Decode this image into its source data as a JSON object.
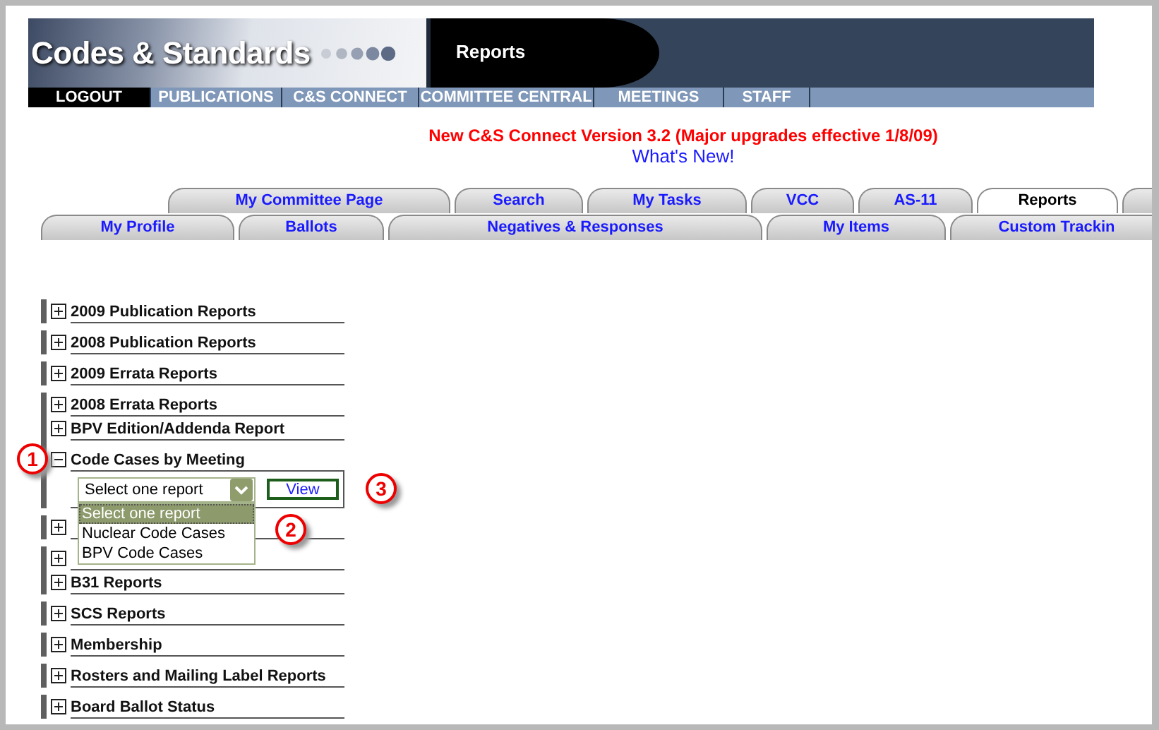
{
  "header": {
    "title": "Codes & Standards",
    "page": "Reports"
  },
  "nav": [
    {
      "label": "LOGOUT",
      "selected": true
    },
    {
      "label": "PUBLICATIONS",
      "selected": false
    },
    {
      "label": "C&S CONNECT",
      "selected": false
    },
    {
      "label": "COMMITTEE CENTRAL",
      "selected": false
    },
    {
      "label": "MEETINGS",
      "selected": false
    },
    {
      "label": "STAFF",
      "selected": false
    }
  ],
  "notice": {
    "text": "New C&S Connect Version 3.2 (Major upgrades effective 1/8/09)",
    "link": "What's New!"
  },
  "tabs_top": [
    {
      "label": "My Committee Page",
      "selected": false
    },
    {
      "label": "Search",
      "selected": false
    },
    {
      "label": "My Tasks",
      "selected": false
    },
    {
      "label": "VCC",
      "selected": false
    },
    {
      "label": "AS-11",
      "selected": false
    },
    {
      "label": "Reports",
      "selected": true
    },
    {
      "selected": false
    }
  ],
  "tabs_bottom": [
    {
      "label": "My Profile",
      "selected": false
    },
    {
      "label": "Ballots",
      "selected": false
    },
    {
      "label": "Negatives & Responses",
      "selected": false
    },
    {
      "label": "My Items",
      "selected": false
    },
    {
      "label": "Custom Trackin",
      "selected": false
    }
  ],
  "report_groups": [
    {
      "items": [
        {
          "label": "2009 Publication Reports",
          "expanded": false
        }
      ]
    },
    {
      "items": [
        {
          "label": "2008 Publication Reports",
          "expanded": false
        }
      ]
    },
    {
      "items": [
        {
          "label": "2009 Errata Reports",
          "expanded": false
        }
      ]
    },
    {
      "items": [
        {
          "label": "2008 Errata Reports",
          "expanded": false
        },
        {
          "label": "BPV Edition/Addenda Report",
          "expanded": false
        },
        {
          "label": "Code Cases by Meeting",
          "expanded": true,
          "callout": "1",
          "panel": {
            "select": {
              "value": "Select one report",
              "open": true,
              "callout": "2",
              "options": [
                {
                  "label": "Select one report",
                  "selected": true
                },
                {
                  "label": "Nuclear Code Cases",
                  "selected": false
                },
                {
                  "label": "BPV Code Cases",
                  "selected": false
                }
              ]
            },
            "button": "View",
            "callout": "3"
          }
        }
      ]
    },
    {
      "items": [
        {
          "expanded": false
        }
      ]
    },
    {
      "items": [
        {
          "expanded": false
        },
        {
          "label": "B31 Reports",
          "expanded": false
        }
      ]
    },
    {
      "items": [
        {
          "label": "SCS Reports",
          "expanded": false
        }
      ]
    },
    {
      "items": [
        {
          "label": "Membership",
          "expanded": false
        }
      ]
    },
    {
      "items": [
        {
          "label": "Rosters and Mailing Label Reports",
          "expanded": false
        }
      ]
    },
    {
      "items": [
        {
          "label": "Board Ballot Status",
          "expanded": false
        }
      ]
    }
  ]
}
